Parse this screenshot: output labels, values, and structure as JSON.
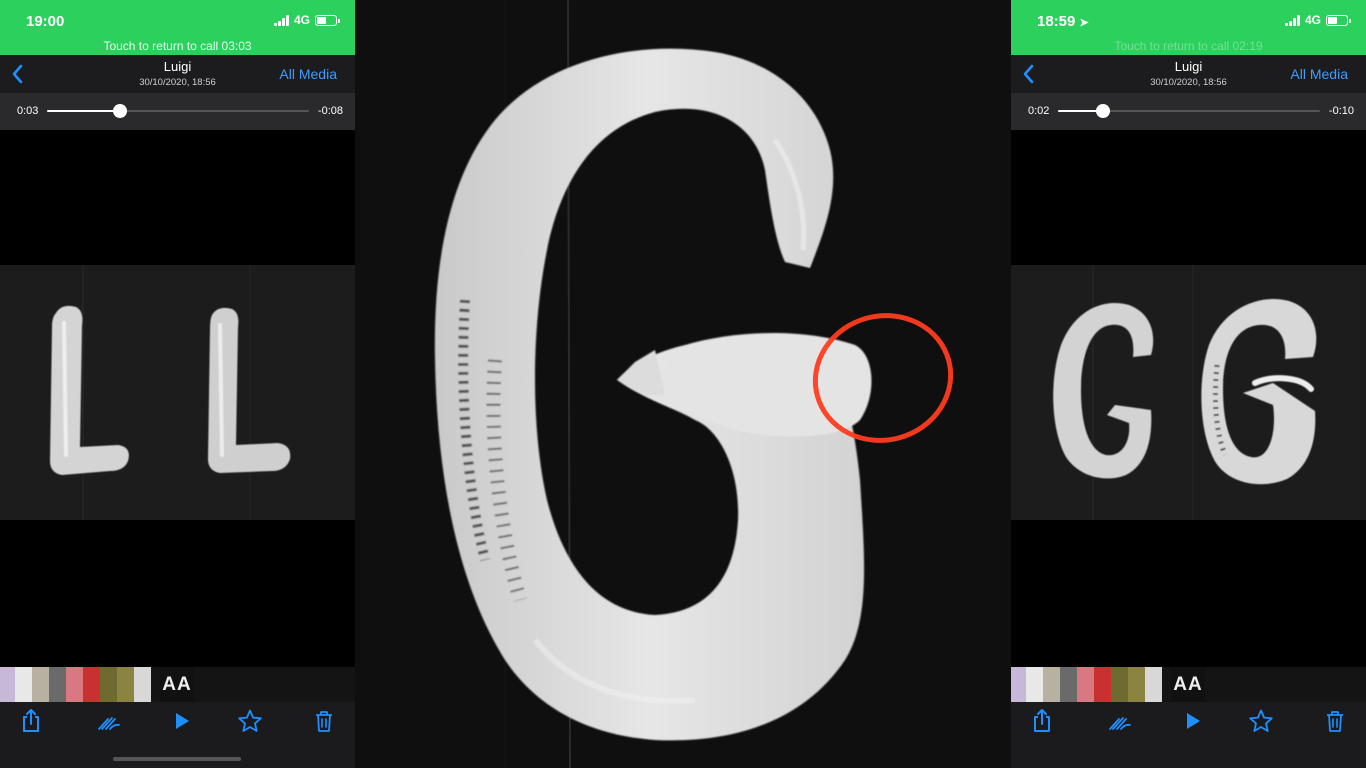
{
  "left_phone": {
    "status": {
      "time": "19:00",
      "network": "4G",
      "call_banner": "Touch to return to call 03:03"
    },
    "nav": {
      "back_icon": "chevron-left-icon",
      "title": "Luigi",
      "subtitle": "30/10/2020, 18:56",
      "all_media": "All Media"
    },
    "player": {
      "elapsed": "0:03",
      "remaining": "-0:08",
      "progress": 0.28
    },
    "media_letters": "L L",
    "thumb_aa": "AA",
    "toolbar": [
      "share-icon",
      "draw-icon",
      "play-icon",
      "star-icon",
      "trash-icon"
    ]
  },
  "right_phone": {
    "status": {
      "time": "18:59",
      "network": "4G",
      "call_banner": "Touch to return to call 02:19"
    },
    "nav": {
      "back_icon": "chevron-left-icon",
      "title": "Luigi",
      "subtitle": "30/10/2020, 18:56",
      "all_media": "All Media"
    },
    "player": {
      "elapsed": "0:02",
      "remaining": "-0:10",
      "progress": 0.17
    },
    "media_letters": "G G",
    "thumb_aa": "AA",
    "toolbar": [
      "share-icon",
      "draw-icon",
      "play-icon",
      "star-icon",
      "trash-icon"
    ]
  },
  "center": {
    "letter": "G",
    "highlight_color": "#ff3b1f"
  },
  "colors": {
    "call_green": "#2bd15c",
    "ios_blue": "#1e8fff",
    "link_blue": "#3f9cff"
  }
}
